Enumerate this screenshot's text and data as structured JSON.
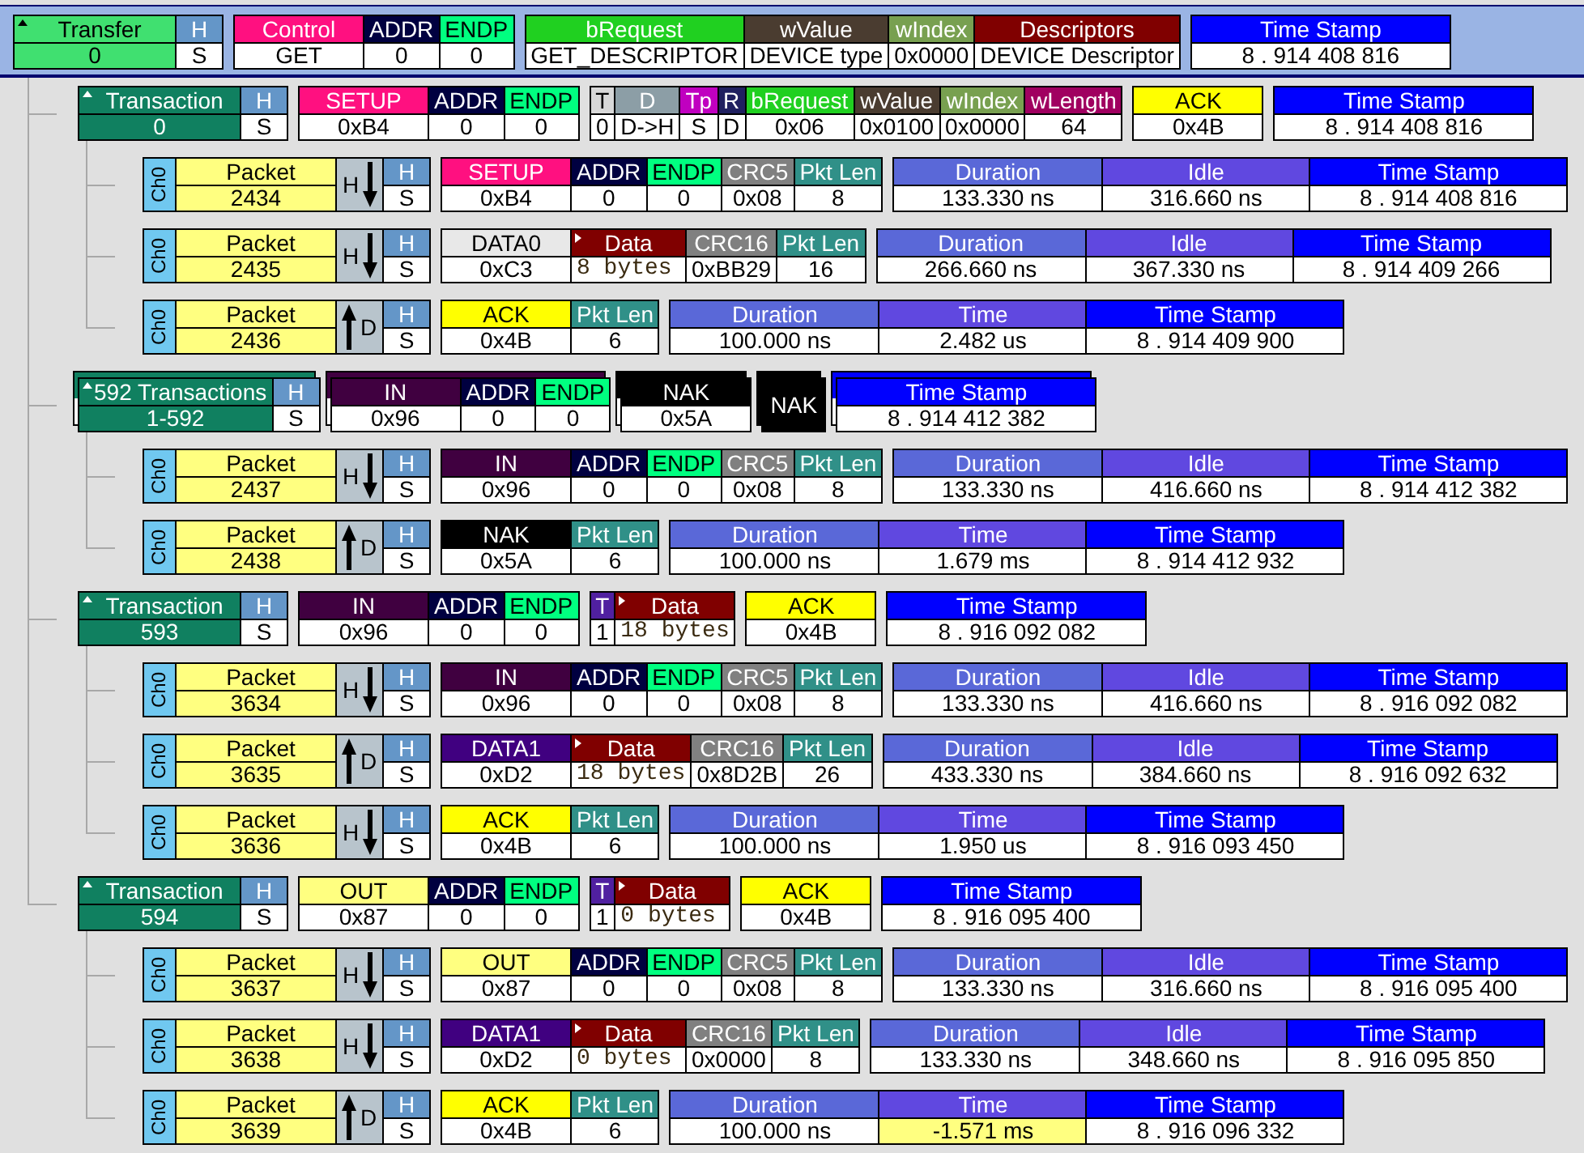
{
  "rows": [
    {
      "kind": "transfer",
      "selected": true,
      "expanded": true,
      "title": "Transfer",
      "number": "0",
      "status_cell": {
        "header": "H",
        "value": "S"
      },
      "groups": [
        {
          "kind": "pid",
          "cells": [
            {
              "header": "Control",
              "value": "GET",
              "color": "#ff1080"
            },
            {
              "header": "ADDR",
              "value": "0",
              "color": "#000040"
            },
            {
              "header": "ENDP",
              "value": "0",
              "color": "#00ff80"
            }
          ]
        },
        {
          "kind": "fields",
          "cells": [
            {
              "header": "bRequest",
              "value": "GET_DESCRIPTOR",
              "color": "#20d020"
            },
            {
              "header": "wValue",
              "value": "DEVICE type",
              "color": "#4a3c30"
            },
            {
              "header": "wIndex",
              "value": "0x0000",
              "color": "#78a050"
            },
            {
              "header": "Descriptors",
              "value": "DEVICE Descriptor",
              "color": "#800000"
            }
          ]
        },
        {
          "kind": "stamp",
          "cells": [
            {
              "header": "Time Stamp",
              "value": "8 . 914 408 816",
              "color": "#0000ff"
            }
          ]
        }
      ],
      "children": [
        {
          "kind": "transaction",
          "selected": false,
          "expanded": true,
          "title": "Transaction",
          "number": "0",
          "status_cell": {
            "header": "H",
            "value": "S"
          },
          "groups": [
            {
              "kind": "pid",
              "cells": [
                {
                  "header": "SETUP",
                  "value": "0xB4",
                  "color": "#ff1080"
                },
                {
                  "header": "ADDR",
                  "value": "0",
                  "color": "#000040"
                },
                {
                  "header": "ENDP",
                  "value": "0",
                  "color": "#00ff80"
                }
              ]
            },
            {
              "kind": "fields",
              "cells": [
                {
                  "header": "T",
                  "value": "0",
                  "color": "#d8d8d8"
                },
                {
                  "header": "D",
                  "value": "D->H",
                  "color": "#8c9ea6"
                },
                {
                  "header": "Tp",
                  "value": "S",
                  "color": "#c000c0"
                },
                {
                  "header": "R",
                  "value": "D",
                  "color": "#202060"
                },
                {
                  "header": "bRequest",
                  "value": "0x06",
                  "color": "#20d020"
                },
                {
                  "header": "wValue",
                  "value": "0x0100",
                  "color": "#4a3c30"
                },
                {
                  "header": "wIndex",
                  "value": "0x0000",
                  "color": "#78a050"
                },
                {
                  "header": "wLength",
                  "value": "64",
                  "color": "#a00060"
                }
              ]
            },
            {
              "kind": "pid",
              "cells": [
                {
                  "header": "ACK",
                  "value": "0x4B",
                  "color": "#ffff00"
                }
              ]
            },
            {
              "kind": "stamp",
              "cells": [
                {
                  "header": "Time Stamp",
                  "value": "8 . 914 408 816",
                  "color": "#0000ff"
                }
              ]
            }
          ],
          "children": [
            {
              "kind": "packet",
              "selected": false,
              "channel": "Ch0",
              "title": "Packet",
              "number": "2434",
              "downward": true,
              "direction_label": "H",
              "status_cell": {
                "header": "H",
                "value": "S"
              },
              "groups": [
                {
                  "kind": "pid",
                  "cells": [
                    {
                      "header": "SETUP",
                      "value": "0xB4",
                      "color": "#ff1080"
                    },
                    {
                      "header": "ADDR",
                      "value": "0",
                      "color": "#000040"
                    },
                    {
                      "header": "ENDP",
                      "value": "0",
                      "color": "#00ff80"
                    },
                    {
                      "header": "CRC5",
                      "value": "0x08",
                      "color": "#808080"
                    },
                    {
                      "header": "Pkt Len",
                      "value": "8",
                      "color": "#309088"
                    }
                  ]
                },
                {
                  "kind": "timing",
                  "cells": [
                    {
                      "header": "Duration",
                      "value": "133.330 ns",
                      "color": "#5a68d8"
                    },
                    {
                      "header": "Idle",
                      "value": "316.660 ns",
                      "color": "#6048e0"
                    },
                    {
                      "header": "Time Stamp",
                      "value": "8 . 914 408 816",
                      "color": "#0000ff"
                    }
                  ]
                }
              ]
            },
            {
              "kind": "packet",
              "selected": false,
              "channel": "Ch0",
              "title": "Packet",
              "number": "2435",
              "downward": true,
              "direction_label": "H",
              "status_cell": {
                "header": "H",
                "value": "S"
              },
              "groups": [
                {
                  "kind": "pid",
                  "cells": [
                    {
                      "header": "DATA0",
                      "value": "0xC3",
                      "color": "#e8e8e8"
                    },
                    {
                      "header": "Data",
                      "value": "8 bytes",
                      "color": "#800000",
                      "expandable": true
                    },
                    {
                      "header": "CRC16",
                      "value": "0xBB29",
                      "color": "#808080"
                    },
                    {
                      "header": "Pkt Len",
                      "value": "16",
                      "color": "#309088"
                    }
                  ]
                },
                {
                  "kind": "timing",
                  "cells": [
                    {
                      "header": "Duration",
                      "value": "266.660 ns",
                      "color": "#5a68d8"
                    },
                    {
                      "header": "Idle",
                      "value": "367.330 ns",
                      "color": "#6048e0"
                    },
                    {
                      "header": "Time Stamp",
                      "value": "8 . 914 409 266",
                      "color": "#0000ff"
                    }
                  ]
                }
              ]
            },
            {
              "kind": "packet",
              "selected": false,
              "channel": "Ch0",
              "title": "Packet",
              "number": "2436",
              "downward": false,
              "direction_label": "D",
              "status_cell": {
                "header": "H",
                "value": "S"
              },
              "groups": [
                {
                  "kind": "pid",
                  "cells": [
                    {
                      "header": "ACK",
                      "value": "0x4B",
                      "color": "#ffff00"
                    },
                    {
                      "header": "Pkt Len",
                      "value": "6",
                      "color": "#309088"
                    }
                  ]
                },
                {
                  "kind": "timing",
                  "cells": [
                    {
                      "header": "Duration",
                      "value": "100.000 ns",
                      "color": "#5a68d8"
                    },
                    {
                      "header": "Time",
                      "value": "2.482 us",
                      "color": "#6048e0"
                    },
                    {
                      "header": "Time Stamp",
                      "value": "8 . 914 409 900",
                      "color": "#0000ff"
                    }
                  ]
                }
              ]
            }
          ]
        },
        {
          "kind": "transactions",
          "selected": false,
          "expanded": true,
          "title": "592 Transactions",
          "number": "1-592",
          "status_cell": {
            "header": "H",
            "value": "S"
          },
          "groups": [
            {
              "kind": "pid",
              "cells": [
                {
                  "header": "IN",
                  "value": "0x96",
                  "color": "#400040"
                },
                {
                  "header": "ADDR",
                  "value": "0",
                  "color": "#000040"
                },
                {
                  "header": "ENDP",
                  "value": "0",
                  "color": "#00ff80"
                }
              ]
            },
            {
              "kind": "pid",
              "cells": [
                {
                  "header": "NAK",
                  "value": "0x5A",
                  "color": "#000000"
                }
              ]
            },
            {
              "kind": "badge",
              "text": "NAK",
              "color": "#000000"
            },
            {
              "kind": "stamp",
              "cells": [
                {
                  "header": "Time Stamp",
                  "value": "8 . 914 412 382",
                  "color": "#0000ff"
                }
              ]
            }
          ],
          "children": [
            {
              "kind": "packet",
              "selected": false,
              "channel": "Ch0",
              "title": "Packet",
              "number": "2437",
              "downward": true,
              "direction_label": "H",
              "status_cell": {
                "header": "H",
                "value": "S"
              },
              "groups": [
                {
                  "kind": "pid",
                  "cells": [
                    {
                      "header": "IN",
                      "value": "0x96",
                      "color": "#400040"
                    },
                    {
                      "header": "ADDR",
                      "value": "0",
                      "color": "#000040"
                    },
                    {
                      "header": "ENDP",
                      "value": "0",
                      "color": "#00ff80"
                    },
                    {
                      "header": "CRC5",
                      "value": "0x08",
                      "color": "#808080"
                    },
                    {
                      "header": "Pkt Len",
                      "value": "8",
                      "color": "#309088"
                    }
                  ]
                },
                {
                  "kind": "timing",
                  "cells": [
                    {
                      "header": "Duration",
                      "value": "133.330 ns",
                      "color": "#5a68d8"
                    },
                    {
                      "header": "Idle",
                      "value": "416.660 ns",
                      "color": "#6048e0"
                    },
                    {
                      "header": "Time Stamp",
                      "value": "8 . 914 412 382",
                      "color": "#0000ff"
                    }
                  ]
                }
              ]
            },
            {
              "kind": "packet",
              "selected": false,
              "channel": "Ch0",
              "title": "Packet",
              "number": "2438",
              "downward": false,
              "direction_label": "D",
              "status_cell": {
                "header": "H",
                "value": "S"
              },
              "groups": [
                {
                  "kind": "pid",
                  "cells": [
                    {
                      "header": "NAK",
                      "value": "0x5A",
                      "color": "#000000"
                    },
                    {
                      "header": "Pkt Len",
                      "value": "6",
                      "color": "#309088"
                    }
                  ]
                },
                {
                  "kind": "timing",
                  "cells": [
                    {
                      "header": "Duration",
                      "value": "100.000 ns",
                      "color": "#5a68d8"
                    },
                    {
                      "header": "Time",
                      "value": "1.679 ms",
                      "color": "#6048e0"
                    },
                    {
                      "header": "Time Stamp",
                      "value": "8 . 914 412 932",
                      "color": "#0000ff"
                    }
                  ]
                }
              ]
            }
          ]
        },
        {
          "kind": "transaction",
          "selected": false,
          "expanded": true,
          "title": "Transaction",
          "number": "593",
          "status_cell": {
            "header": "H",
            "value": "S"
          },
          "groups": [
            {
              "kind": "pid",
              "cells": [
                {
                  "header": "IN",
                  "value": "0x96",
                  "color": "#400040"
                },
                {
                  "header": "ADDR",
                  "value": "0",
                  "color": "#000040"
                },
                {
                  "header": "ENDP",
                  "value": "0",
                  "color": "#00ff80"
                }
              ]
            },
            {
              "kind": "fields",
              "cells": [
                {
                  "header": "T",
                  "value": "1",
                  "color": "#5020a0"
                },
                {
                  "header": "Data",
                  "value": "18 bytes",
                  "color": "#800000",
                  "expandable": true
                }
              ]
            },
            {
              "kind": "pid",
              "cells": [
                {
                  "header": "ACK",
                  "value": "0x4B",
                  "color": "#ffff00"
                }
              ]
            },
            {
              "kind": "stamp",
              "cells": [
                {
                  "header": "Time Stamp",
                  "value": "8 . 916 092 082",
                  "color": "#0000ff"
                }
              ]
            }
          ],
          "children": [
            {
              "kind": "packet",
              "selected": false,
              "channel": "Ch0",
              "title": "Packet",
              "number": "3634",
              "downward": true,
              "direction_label": "H",
              "status_cell": {
                "header": "H",
                "value": "S"
              },
              "groups": [
                {
                  "kind": "pid",
                  "cells": [
                    {
                      "header": "IN",
                      "value": "0x96",
                      "color": "#400040"
                    },
                    {
                      "header": "ADDR",
                      "value": "0",
                      "color": "#000040"
                    },
                    {
                      "header": "ENDP",
                      "value": "0",
                      "color": "#00ff80"
                    },
                    {
                      "header": "CRC5",
                      "value": "0x08",
                      "color": "#808080"
                    },
                    {
                      "header": "Pkt Len",
                      "value": "8",
                      "color": "#309088"
                    }
                  ]
                },
                {
                  "kind": "timing",
                  "cells": [
                    {
                      "header": "Duration",
                      "value": "133.330 ns",
                      "color": "#5a68d8"
                    },
                    {
                      "header": "Idle",
                      "value": "416.660 ns",
                      "color": "#6048e0"
                    },
                    {
                      "header": "Time Stamp",
                      "value": "8 . 916 092 082",
                      "color": "#0000ff"
                    }
                  ]
                }
              ]
            },
            {
              "kind": "packet",
              "selected": false,
              "channel": "Ch0",
              "title": "Packet",
              "number": "3635",
              "downward": false,
              "direction_label": "D",
              "status_cell": {
                "header": "H",
                "value": "S"
              },
              "groups": [
                {
                  "kind": "pid",
                  "cells": [
                    {
                      "header": "DATA1",
                      "value": "0xD2",
                      "color": "#400080"
                    },
                    {
                      "header": "Data",
                      "value": "18 bytes",
                      "color": "#800000",
                      "expandable": true
                    },
                    {
                      "header": "CRC16",
                      "value": "0x8D2B",
                      "color": "#808080"
                    },
                    {
                      "header": "Pkt Len",
                      "value": "26",
                      "color": "#309088"
                    }
                  ]
                },
                {
                  "kind": "timing",
                  "cells": [
                    {
                      "header": "Duration",
                      "value": "433.330 ns",
                      "color": "#5a68d8"
                    },
                    {
                      "header": "Idle",
                      "value": "384.660 ns",
                      "color": "#6048e0"
                    },
                    {
                      "header": "Time Stamp",
                      "value": "8 . 916 092 632",
                      "color": "#0000ff"
                    }
                  ]
                }
              ]
            },
            {
              "kind": "packet",
              "selected": false,
              "channel": "Ch0",
              "title": "Packet",
              "number": "3636",
              "downward": true,
              "direction_label": "H",
              "status_cell": {
                "header": "H",
                "value": "S"
              },
              "groups": [
                {
                  "kind": "pid",
                  "cells": [
                    {
                      "header": "ACK",
                      "value": "0x4B",
                      "color": "#ffff00"
                    },
                    {
                      "header": "Pkt Len",
                      "value": "6",
                      "color": "#309088"
                    }
                  ]
                },
                {
                  "kind": "timing",
                  "cells": [
                    {
                      "header": "Duration",
                      "value": "100.000 ns",
                      "color": "#5a68d8"
                    },
                    {
                      "header": "Time",
                      "value": "1.950 us",
                      "color": "#6048e0"
                    },
                    {
                      "header": "Time Stamp",
                      "value": "8 . 916 093 450",
                      "color": "#0000ff"
                    }
                  ]
                }
              ]
            }
          ]
        },
        {
          "kind": "transaction",
          "selected": false,
          "expanded": true,
          "title": "Transaction",
          "number": "594",
          "status_cell": {
            "header": "H",
            "value": "S"
          },
          "groups": [
            {
              "kind": "pid",
              "cells": [
                {
                  "header": "OUT",
                  "value": "0x87",
                  "color": "#ffff80"
                },
                {
                  "header": "ADDR",
                  "value": "0",
                  "color": "#000040"
                },
                {
                  "header": "ENDP",
                  "value": "0",
                  "color": "#00ff80"
                }
              ]
            },
            {
              "kind": "fields",
              "cells": [
                {
                  "header": "T",
                  "value": "1",
                  "color": "#5020a0"
                },
                {
                  "header": "Data",
                  "value": "0 bytes",
                  "color": "#800000",
                  "expandable": true
                }
              ]
            },
            {
              "kind": "pid",
              "cells": [
                {
                  "header": "ACK",
                  "value": "0x4B",
                  "color": "#ffff00"
                }
              ]
            },
            {
              "kind": "stamp",
              "cells": [
                {
                  "header": "Time Stamp",
                  "value": "8 . 916 095 400",
                  "color": "#0000ff"
                }
              ]
            }
          ],
          "children": [
            {
              "kind": "packet",
              "selected": false,
              "channel": "Ch0",
              "title": "Packet",
              "number": "3637",
              "downward": true,
              "direction_label": "H",
              "status_cell": {
                "header": "H",
                "value": "S"
              },
              "groups": [
                {
                  "kind": "pid",
                  "cells": [
                    {
                      "header": "OUT",
                      "value": "0x87",
                      "color": "#ffff80"
                    },
                    {
                      "header": "ADDR",
                      "value": "0",
                      "color": "#000040"
                    },
                    {
                      "header": "ENDP",
                      "value": "0",
                      "color": "#00ff80"
                    },
                    {
                      "header": "CRC5",
                      "value": "0x08",
                      "color": "#808080"
                    },
                    {
                      "header": "Pkt Len",
                      "value": "8",
                      "color": "#309088"
                    }
                  ]
                },
                {
                  "kind": "timing",
                  "cells": [
                    {
                      "header": "Duration",
                      "value": "133.330 ns",
                      "color": "#5a68d8"
                    },
                    {
                      "header": "Idle",
                      "value": "316.660 ns",
                      "color": "#6048e0"
                    },
                    {
                      "header": "Time Stamp",
                      "value": "8 . 916 095 400",
                      "color": "#0000ff"
                    }
                  ]
                }
              ]
            },
            {
              "kind": "packet",
              "selected": false,
              "channel": "Ch0",
              "title": "Packet",
              "number": "3638",
              "downward": true,
              "direction_label": "H",
              "status_cell": {
                "header": "H",
                "value": "S"
              },
              "groups": [
                {
                  "kind": "pid",
                  "cells": [
                    {
                      "header": "DATA1",
                      "value": "0xD2",
                      "color": "#400080"
                    },
                    {
                      "header": "Data",
                      "value": "0 bytes",
                      "color": "#800000",
                      "expandable": true
                    },
                    {
                      "header": "CRC16",
                      "value": "0x0000",
                      "color": "#808080"
                    },
                    {
                      "header": "Pkt Len",
                      "value": "8",
                      "color": "#309088"
                    }
                  ]
                },
                {
                  "kind": "timing",
                  "cells": [
                    {
                      "header": "Duration",
                      "value": "133.330 ns",
                      "color": "#5a68d8"
                    },
                    {
                      "header": "Idle",
                      "value": "348.660 ns",
                      "color": "#6048e0"
                    },
                    {
                      "header": "Time Stamp",
                      "value": "8 . 916 095 850",
                      "color": "#0000ff"
                    }
                  ]
                }
              ]
            },
            {
              "kind": "packet",
              "selected": false,
              "channel": "Ch0",
              "title": "Packet",
              "number": "3639",
              "downward": false,
              "direction_label": "D",
              "status_cell": {
                "header": "H",
                "value": "S"
              },
              "groups": [
                {
                  "kind": "pid",
                  "cells": [
                    {
                      "header": "ACK",
                      "value": "0x4B",
                      "color": "#ffff00"
                    },
                    {
                      "header": "Pkt Len",
                      "value": "6",
                      "color": "#309088"
                    }
                  ]
                },
                {
                  "kind": "timing",
                  "cells": [
                    {
                      "header": "Duration",
                      "value": "100.000 ns",
                      "color": "#5a68d8"
                    },
                    {
                      "header": "Time",
                      "value": "-1.571 ms",
                      "color": "#6048e0",
                      "highlighted": true
                    },
                    {
                      "header": "Time Stamp",
                      "value": "8 . 916 096 332",
                      "color": "#0000ff"
                    }
                  ]
                }
              ]
            }
          ]
        }
      ]
    }
  ]
}
